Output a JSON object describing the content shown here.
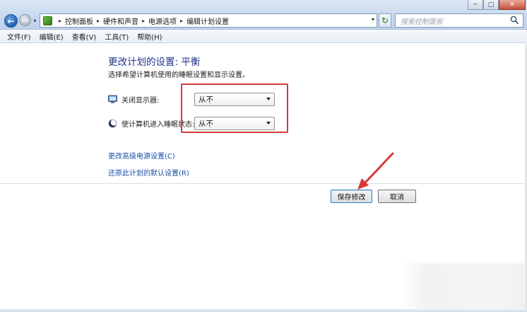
{
  "window_controls": {
    "minimize": "─",
    "maximize": "□",
    "close": "✕"
  },
  "nav": {
    "back_glyph": "←",
    "forward_glyph": "→",
    "history_glyph": "▾"
  },
  "address": {
    "crumbs": [
      "控制面板",
      "硬件和声音",
      "电源选项",
      "编辑计划设置"
    ],
    "separator": "▸",
    "dropdown_glyph": "▾",
    "refresh_glyph": "↻"
  },
  "search": {
    "placeholder": "搜索控制面板"
  },
  "menu": {
    "items": [
      "文件(F)",
      "编辑(E)",
      "查看(V)",
      "工具(T)",
      "帮助(H)"
    ]
  },
  "main": {
    "title": "更改计划的设置: 平衡",
    "subtitle": "选择希望计算机使用的睡眠设置和显示设置。",
    "settings": [
      {
        "label": "关闭显示器:",
        "value": "从不",
        "icon": "monitor-icon"
      },
      {
        "label": "使计算机进入睡眠状态:",
        "value": "从不",
        "icon": "sleep-moon-icon"
      }
    ],
    "links": {
      "advanced": "更改高级电源设置(C)",
      "restore": "还原此计划的默认设置(R)"
    },
    "buttons": {
      "save": "保存修改",
      "cancel": "取消"
    }
  },
  "annotations": {
    "highlight_color": "#d63a3a",
    "arrow_color": "#d63a3a"
  },
  "colors": {
    "title": "#1e3287",
    "link": "#1b4fa5",
    "accent_border": "#3c7fb1"
  }
}
